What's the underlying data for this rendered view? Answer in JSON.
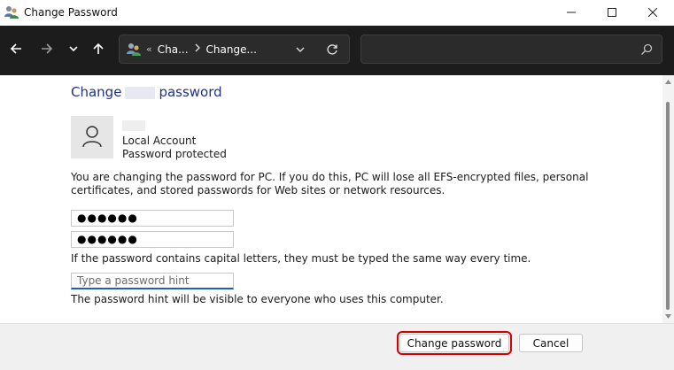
{
  "window": {
    "title": "Change Password",
    "icons": {
      "app": "users-icon",
      "minimize": "minimize-icon",
      "maximize": "maximize-icon",
      "close": "close-icon"
    }
  },
  "nav": {
    "breadcrumb_overflow": "«",
    "crumbs": [
      "Cha...",
      "Change..."
    ],
    "icons": {
      "back": "arrow-left-icon",
      "forward": "arrow-right-icon",
      "recent": "chevron-down-icon",
      "up": "arrow-up-icon",
      "dropdown": "chevron-down-icon",
      "refresh": "refresh-icon",
      "search": "search-icon"
    },
    "search_placeholder": ""
  },
  "page": {
    "title_prefix": "Change",
    "title_suffix": "password",
    "account_type": "Local Account",
    "account_status": "Password protected",
    "description": "You are changing the password for PC.  If you do this, PC will lose all EFS-encrypted files, personal certificates, and stored passwords for Web sites or network resources.",
    "new_password_value": "●●●●●●",
    "confirm_password_value": "●●●●●●",
    "case_note": "If the password contains capital letters, they must be typed the same way every time.",
    "hint_placeholder": "Type a password hint",
    "hint_note": "The password hint will be visible to everyone who uses this computer."
  },
  "footer": {
    "change_label": "Change password",
    "cancel_label": "Cancel"
  },
  "colors": {
    "title_blue": "#1e3287",
    "nav_bg": "#1c1c1c",
    "highlight_red": "#d40000",
    "focus_blue": "#1e5fc2"
  }
}
